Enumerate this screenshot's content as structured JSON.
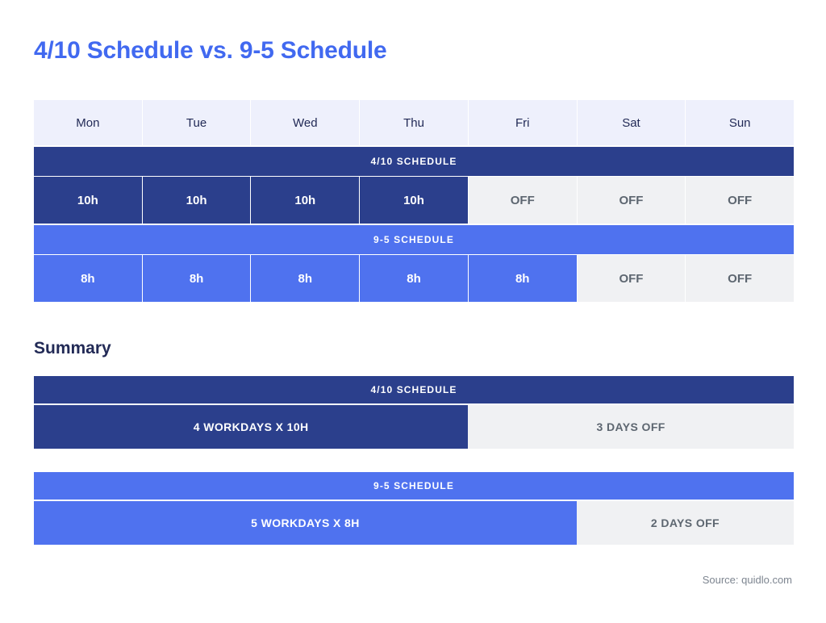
{
  "title": "4/10 Schedule vs. 9-5 Schedule",
  "summary_heading": "Summary",
  "source": "Source: quidlo.com",
  "colors": {
    "title_blue": "#4169f0",
    "navy": "#2b3f8c",
    "blue": "#4f72ef",
    "off_gray_bg": "#f0f1f3",
    "off_gray_text": "#5d6670",
    "header_bg": "#eef0fc",
    "header_text": "#222a56"
  },
  "table": {
    "day_headers": [
      "Mon",
      "Tue",
      "Wed",
      "Thu",
      "Fri",
      "Sat",
      "Sun"
    ],
    "schedules": [
      {
        "band_label": "4/10 SCHEDULE",
        "cells": [
          "10h",
          "10h",
          "10h",
          "10h",
          "OFF",
          "OFF",
          "OFF"
        ],
        "work_days": 4,
        "off_days": 3,
        "hours_per_day": "10h"
      },
      {
        "band_label": "9-5 SCHEDULE",
        "cells": [
          "8h",
          "8h",
          "8h",
          "8h",
          "8h",
          "OFF",
          "OFF"
        ],
        "work_days": 5,
        "off_days": 2,
        "hours_per_day": "8h"
      }
    ]
  },
  "summary": [
    {
      "band_label": "4/10 SCHEDULE",
      "work_label": "4 WORKDAYS X 10H",
      "off_label": "3 DAYS OFF",
      "work_flex": 4,
      "off_flex": 3
    },
    {
      "band_label": "9-5 SCHEDULE",
      "work_label": "5 WORKDAYS X 8H",
      "off_label": "2 DAYS OFF",
      "work_flex": 5,
      "off_flex": 2
    }
  ]
}
